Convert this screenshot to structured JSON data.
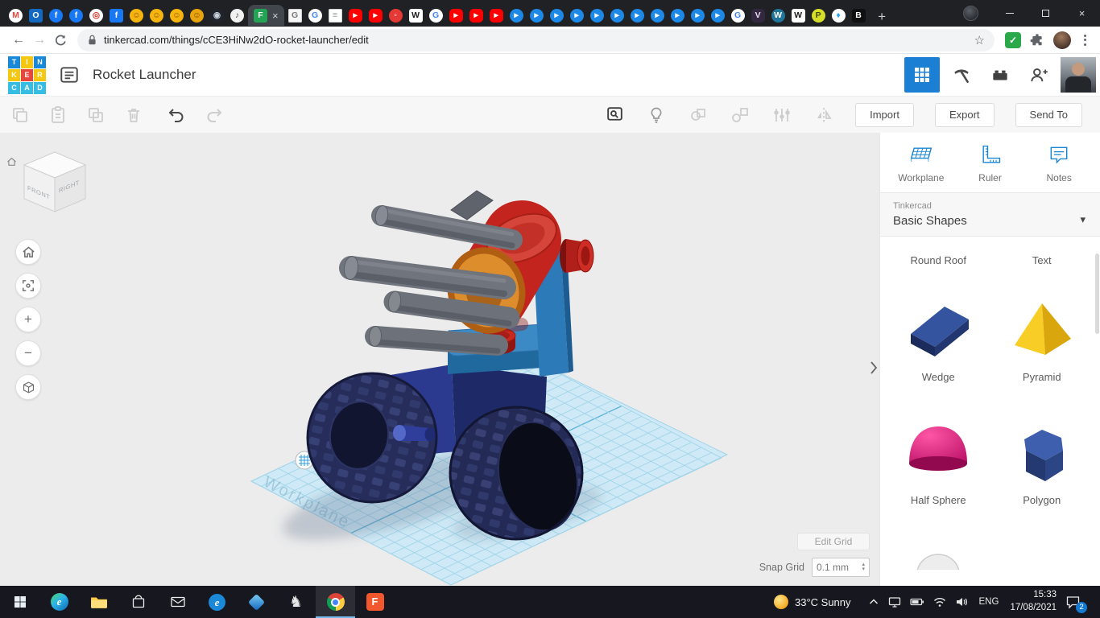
{
  "browser": {
    "nav_back_glyph": "←",
    "nav_forward_glyph": "→",
    "url": "tinkercad.com/things/cCE3HiNw2dO-rocket-launcher/edit",
    "star_glyph": "☆",
    "ext_check_glyph": "✓",
    "new_tab_glyph": "+",
    "close_glyph": "×",
    "tabs": [
      {
        "n": "gmail",
        "g": "M",
        "bg": "#ffffff",
        "fg": "#e8453c",
        "s": "c"
      },
      {
        "n": "outlook",
        "g": "O",
        "bg": "#1269bf",
        "fg": "#ffffff",
        "s": "q"
      },
      {
        "n": "facebook",
        "g": "f",
        "bg": "#1877f2",
        "fg": "#ffffff",
        "s": "c"
      },
      {
        "n": "facebook",
        "g": "f",
        "bg": "#1877f2",
        "fg": "#ffffff",
        "s": "c"
      },
      {
        "n": "target",
        "g": "◎",
        "bg": "#ffffff",
        "fg": "#d93025",
        "s": "c"
      },
      {
        "n": "facebook-sq",
        "g": "f",
        "bg": "#1877f2",
        "fg": "#ffffff",
        "s": "q"
      },
      {
        "n": "emoji",
        "g": "☺",
        "bg": "#f6b40e",
        "fg": "#8a5200",
        "s": "c"
      },
      {
        "n": "emoji",
        "g": "☺",
        "bg": "#f6b40e",
        "fg": "#8a5200",
        "s": "c"
      },
      {
        "n": "emoji",
        "g": "☺",
        "bg": "#f6b40e",
        "fg": "#8a5200",
        "s": "c"
      },
      {
        "n": "emoji",
        "g": "☺",
        "bg": "#e8a40c",
        "fg": "#7a4a00",
        "s": "c"
      },
      {
        "n": "steam",
        "g": "◉",
        "bg": "#20242e",
        "fg": "#c9d3dd",
        "s": "c"
      },
      {
        "n": "voice",
        "g": "♪",
        "bg": "#f1f1f1",
        "fg": "#555555",
        "s": "c"
      },
      {
        "n": "green-f",
        "g": "F",
        "bg": "#23a455",
        "fg": "#ffffff",
        "s": "q",
        "active": true
      },
      {
        "n": "translate",
        "g": "G",
        "bg": "#f6f6f6",
        "fg": "#7a7a7a",
        "s": "p"
      },
      {
        "n": "google",
        "g": "G",
        "bg": "#ffffff",
        "fg": "#4285f4",
        "s": "c"
      },
      {
        "n": "doc",
        "g": "≡",
        "bg": "#ffffff",
        "fg": "#9aa0a6",
        "s": "p"
      },
      {
        "n": "youtube",
        "g": "▸",
        "bg": "#ff0000",
        "fg": "#ffffff",
        "s": "r"
      },
      {
        "n": "youtube",
        "g": "▸",
        "bg": "#ff0000",
        "fg": "#ffffff",
        "s": "r"
      },
      {
        "n": "red-dot",
        "g": "◦",
        "bg": "#e53935",
        "fg": "#ffffff",
        "s": "c"
      },
      {
        "n": "wikipedia",
        "g": "W",
        "bg": "#ffffff",
        "fg": "#1b1b1b",
        "s": "q"
      },
      {
        "n": "google",
        "g": "G",
        "bg": "#ffffff",
        "fg": "#4285f4",
        "s": "c"
      },
      {
        "n": "youtube",
        "g": "▸",
        "bg": "#ff0000",
        "fg": "#ffffff",
        "s": "r"
      },
      {
        "n": "youtube",
        "g": "▸",
        "bg": "#ff0000",
        "fg": "#ffffff",
        "s": "r"
      },
      {
        "n": "youtube",
        "g": "▸",
        "bg": "#ff0000",
        "fg": "#ffffff",
        "s": "r"
      },
      {
        "n": "blue-play",
        "g": "▸",
        "bg": "#1d88e5",
        "fg": "#ffffff",
        "s": "c"
      },
      {
        "n": "blue-play",
        "g": "▸",
        "bg": "#1d88e5",
        "fg": "#ffffff",
        "s": "c"
      },
      {
        "n": "blue-play",
        "g": "▸",
        "bg": "#1d88e5",
        "fg": "#ffffff",
        "s": "c"
      },
      {
        "n": "blue-play",
        "g": "▸",
        "bg": "#1d88e5",
        "fg": "#ffffff",
        "s": "c"
      },
      {
        "n": "blue-play",
        "g": "▸",
        "bg": "#1d88e5",
        "fg": "#ffffff",
        "s": "c"
      },
      {
        "n": "blue-play",
        "g": "▸",
        "bg": "#1d88e5",
        "fg": "#ffffff",
        "s": "c"
      },
      {
        "n": "blue-play",
        "g": "▸",
        "bg": "#1d88e5",
        "fg": "#ffffff",
        "s": "c"
      },
      {
        "n": "blue-play",
        "g": "▸",
        "bg": "#1d88e5",
        "fg": "#ffffff",
        "s": "c"
      },
      {
        "n": "blue-play",
        "g": "▸",
        "bg": "#1d88e5",
        "fg": "#ffffff",
        "s": "c"
      },
      {
        "n": "blue-play",
        "g": "▸",
        "bg": "#1d88e5",
        "fg": "#ffffff",
        "s": "c"
      },
      {
        "n": "blue-play",
        "g": "▸",
        "bg": "#1d88e5",
        "fg": "#ffffff",
        "s": "c"
      },
      {
        "n": "google",
        "g": "G",
        "bg": "#ffffff",
        "fg": "#4285f4",
        "s": "c"
      },
      {
        "n": "vanced",
        "g": "V",
        "bg": "#33283f",
        "fg": "#e6def5",
        "s": "r"
      },
      {
        "n": "wordpress",
        "g": "W",
        "bg": "#21759b",
        "fg": "#ffffff",
        "s": "c"
      },
      {
        "n": "wikipedia",
        "g": "W",
        "bg": "#ffffff",
        "fg": "#1b1b1b",
        "s": "q"
      },
      {
        "n": "p2",
        "g": "P",
        "bg": "#d7de2a",
        "fg": "#3c4a00",
        "s": "c"
      },
      {
        "n": "blue-gem",
        "g": "♦",
        "bg": "#ffffff",
        "fg": "#29a3ef",
        "s": "c"
      },
      {
        "n": "bim",
        "g": "B",
        "bg": "#101010",
        "fg": "#ffffff",
        "s": "q"
      }
    ]
  },
  "app_header": {
    "logo_tiles": [
      {
        "ch": "T",
        "bg": "#1789d8"
      },
      {
        "ch": "I",
        "bg": "#f5c70e"
      },
      {
        "ch": "N",
        "bg": "#1789d8"
      },
      {
        "ch": "K",
        "bg": "#f5c70e"
      },
      {
        "ch": "E",
        "bg": "#e8453c"
      },
      {
        "ch": "R",
        "bg": "#f5c70e"
      },
      {
        "ch": "C",
        "bg": "#35bde4"
      },
      {
        "ch": "A",
        "bg": "#35bde4"
      },
      {
        "ch": "D",
        "bg": "#35bde4"
      }
    ],
    "title": "Rocket Launcher"
  },
  "edit_toolbar": {
    "import_label": "Import",
    "export_label": "Export",
    "send_to_label": "Send To"
  },
  "viewport": {
    "viewcube_front": "FRONT",
    "viewcube_right": "RIGHT",
    "zoom_in_glyph": "+",
    "zoom_out_glyph": "−",
    "workplane_watermark": "Workplane",
    "edit_grid_label": "Edit Grid",
    "snap_grid_label": "Snap Grid",
    "snap_grid_value": "0.1 mm",
    "spinner_up": "▴",
    "spinner_down": "▾"
  },
  "shapes_panel": {
    "tools": [
      {
        "label": "Workplane"
      },
      {
        "label": "Ruler"
      },
      {
        "label": "Notes"
      }
    ],
    "library_kicker": "Tinkercad",
    "library_title": "Basic Shapes",
    "dropdown_caret": "▾",
    "partial_labels": [
      "Round Roof",
      "Text"
    ],
    "shapes": [
      {
        "label": "Wedge"
      },
      {
        "label": "Pyramid"
      },
      {
        "label": "Half Sphere"
      },
      {
        "label": "Polygon"
      }
    ]
  },
  "taskbar": {
    "edge_glyph": "e",
    "knight_glyph": "♞",
    "f_label": "F",
    "weather": "33°C Sunny",
    "language": "ENG",
    "time": "15:33",
    "date": "17/08/2021",
    "notification_badge": "2"
  },
  "colors": {
    "accent_blue": "#1b7fd4",
    "workplane": "#cfeaf6",
    "model_red": "#c3241d",
    "model_orange": "#de8d2c",
    "model_navy": "#242b58",
    "model_arm_blue": "#2d7ab8",
    "rocket_gray": "#70747c"
  }
}
